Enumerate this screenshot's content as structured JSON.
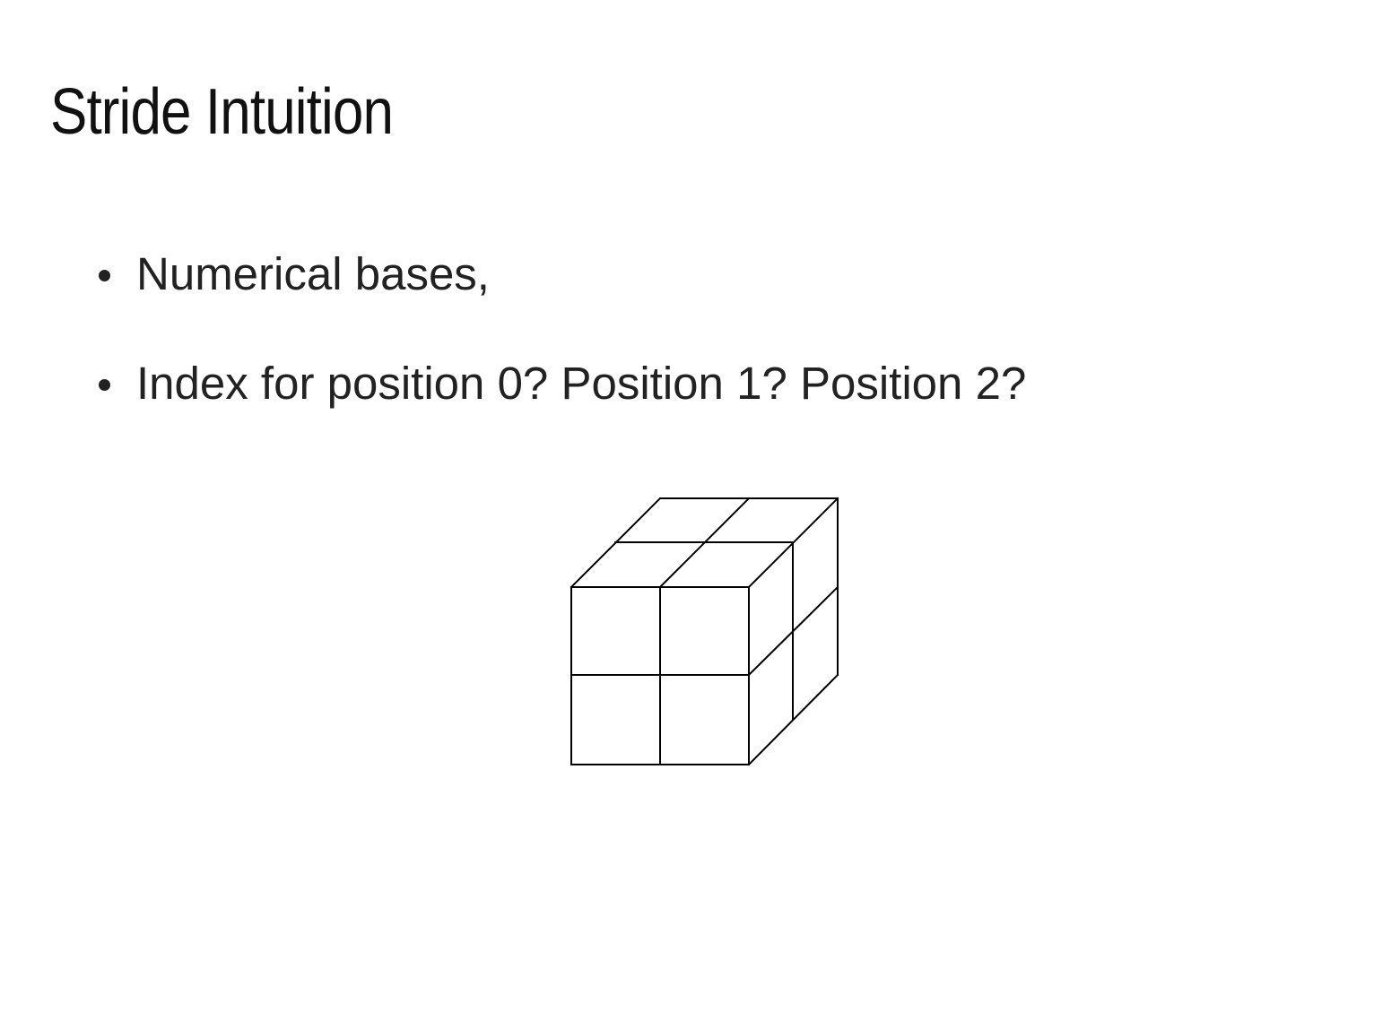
{
  "slide": {
    "title": "Stride Intuition",
    "bullets": [
      "Numerical bases,",
      "Index for position 0? Position 1? Position 2?"
    ]
  },
  "figure": {
    "icon": "2x2x2-cube-grid",
    "stroke_color": "#000000"
  }
}
